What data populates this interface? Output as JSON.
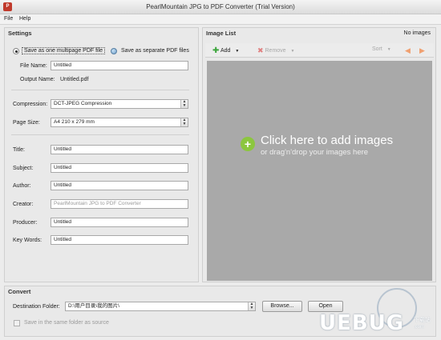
{
  "window": {
    "title": "PearlMountain JPG to PDF Converter (Trial Version)",
    "icon_text": "P"
  },
  "menu": {
    "file_label": "File",
    "help_label": "Help"
  },
  "settings": {
    "title": "Settings",
    "save_multi_label": "Save as one multipage PDF file",
    "save_separate_label": "Save as separate PDF files",
    "file_name_label": "File Name:",
    "file_name_value": "Untitled",
    "output_name_label": "Output Name:",
    "output_name_value": "Untitled.pdf",
    "compression_label": "Compression:",
    "compression_value": "DCT-JPEG Compression",
    "page_size_label": "Page Size:",
    "page_size_value": "A4 210 x 279 mm",
    "title_label": "Title:",
    "title_value": "Untitled",
    "subject_label": "Subject:",
    "subject_value": "Untitled",
    "author_label": "Author:",
    "author_value": "Untitled",
    "creator_label": "Creator:",
    "creator_value": "PearlMountain JPG to PDF Converter",
    "producer_label": "Producer:",
    "producer_value": "Untitled",
    "keywords_label": "Key Words:",
    "keywords_value": "Untitled"
  },
  "image_list": {
    "title": "Image List",
    "status": "No images",
    "add_label": "Add",
    "remove_label": "Remove",
    "sort_label": "Sort",
    "click_here": "Click here  to add images",
    "drag_drop": "or drag'n'drop your images here",
    "caret": "▼",
    "left_arrow": "◀",
    "right_arrow": "▶"
  },
  "convert": {
    "title": "Convert",
    "destination_label": "Destination Folder:",
    "destination_value": "D:\\用户目录\\我的图片\\",
    "browse_label": "Browse...",
    "open_label": "Open",
    "same_folder_label": "Save in the same folder as source"
  },
  "watermark": {
    "text": "UEBUG",
    "small_text": "下载站",
    "small_sub": ".com"
  },
  "colors": {
    "dropzone": "#a9a9a9",
    "add_green": "#8cc63f",
    "remove_red": "#e08080"
  }
}
